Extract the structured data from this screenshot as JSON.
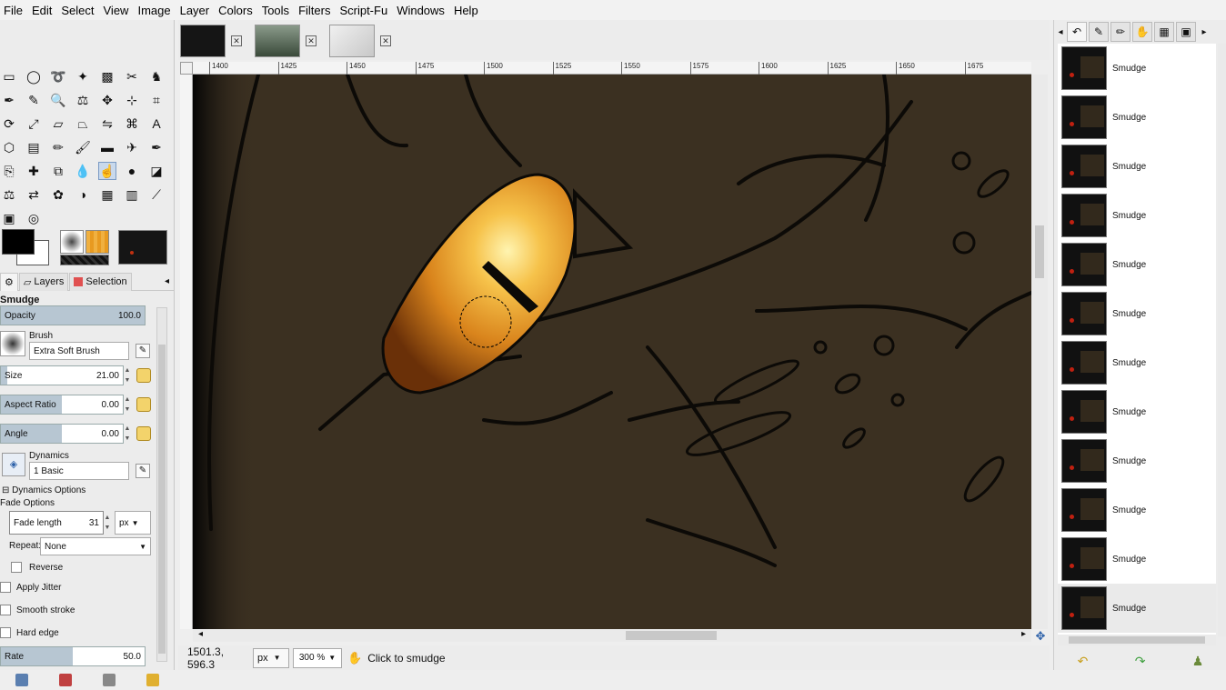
{
  "menubar": [
    "File",
    "Edit",
    "Select",
    "View",
    "Image",
    "Layer",
    "Colors",
    "Tools",
    "Filters",
    "Script-Fu",
    "Windows",
    "Help"
  ],
  "dock_tabs": {
    "layers": "Layers",
    "selection": "Selection"
  },
  "tool_options": {
    "title": "Smudge",
    "opacity_label": "Opacity",
    "opacity_value": "100.0",
    "opacity_fill": 1.0,
    "brush_label": "Brush",
    "brush_value": "Extra Soft Brush",
    "size_label": "Size",
    "size_value": "21.00",
    "size_fill": 0.05,
    "aspect_label": "Aspect Ratio",
    "aspect_value": "0.00",
    "aspect_fill": 0.5,
    "angle_label": "Angle",
    "angle_value": "0.00",
    "angle_fill": 0.5,
    "dynamics_label": "Dynamics",
    "dynamics_value": "1 Basic",
    "dynamics_options_label": "Dynamics Options",
    "fade_options_label": "Fade Options",
    "fade_length_label": "Fade length",
    "fade_length_value": "31",
    "fade_unit": "px",
    "repeat_label": "Repeat:",
    "repeat_value": "None",
    "reverse_label": "Reverse",
    "apply_jitter_label": "Apply Jitter",
    "smooth_stroke_label": "Smooth stroke",
    "hard_edge_label": "Hard edge",
    "rate_label": "Rate",
    "rate_value": "50.0",
    "rate_fill": 0.5
  },
  "ruler": {
    "ticks": [
      "1400",
      "1425",
      "1450",
      "1475",
      "1500",
      "1525",
      "1550",
      "1575",
      "1600",
      "1625",
      "1650",
      "1675"
    ]
  },
  "status": {
    "coords": "1501.3, 596.3",
    "unit": "px",
    "zoom": "300 %",
    "message": "Click to smudge"
  },
  "history": {
    "items": [
      "Smudge",
      "Smudge",
      "Smudge",
      "Smudge",
      "Smudge",
      "Smudge",
      "Smudge",
      "Smudge",
      "Smudge",
      "Smudge",
      "Smudge",
      "Smudge"
    ],
    "selected_index": 11
  },
  "colors": {
    "canvas_bg": "#3b3021",
    "eye_orange": "#e08a1a",
    "selection_blue": "#c9d9ec"
  }
}
